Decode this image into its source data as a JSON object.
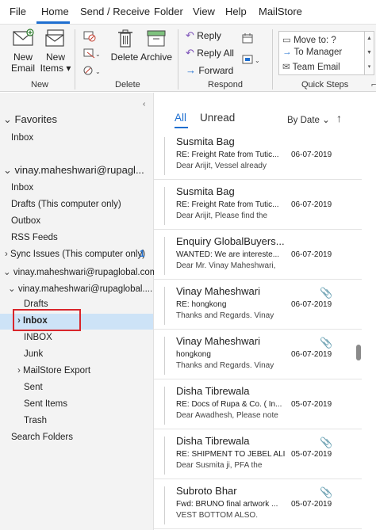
{
  "menu": {
    "items": [
      "File",
      "Home",
      "Send / Receive",
      "Folder",
      "View",
      "Help",
      "MailStore"
    ],
    "active": "Home"
  },
  "ribbon": {
    "new_group": {
      "new_email": [
        "New",
        "Email"
      ],
      "new_items": [
        "New",
        "Items ▾"
      ],
      "label": "New"
    },
    "delete_group": {
      "delete": "Delete",
      "archive": "Archive",
      "label": "Delete"
    },
    "respond_group": {
      "reply": "Reply",
      "reply_all": "Reply All",
      "forward": "Forward",
      "label": "Respond"
    },
    "quick_steps": {
      "items": [
        "Move to: ?",
        "To Manager",
        "Team Email"
      ],
      "label": "Quick Steps"
    }
  },
  "folders": {
    "favorites_header": "Favorites",
    "favorites_inbox": "Inbox",
    "account1": "vinay.maheshwari@rupagl...",
    "inbox": "Inbox",
    "drafts_local": "Drafts (This computer only)",
    "outbox": "Outbox",
    "rss": "RSS Feeds",
    "sync_issues": "Sync Issues (This computer only)",
    "sync_count": "1",
    "account2": "vinay.maheshwari@rupaglobal.com",
    "account2_sub": "vinay.maheshwari@rupaglobal....",
    "drafts": "Drafts",
    "inbox_selected": "Inbox",
    "inbox_caps": "INBOX",
    "junk": "Junk",
    "mailstore_export": "MailStore Export",
    "sent": "Sent",
    "sent_items": "Sent Items",
    "trash": "Trash",
    "search_folders": "Search Folders"
  },
  "list": {
    "tab_all": "All",
    "tab_unread": "Unread",
    "sort_label": "By Date ⌄",
    "sort_direction": "↑"
  },
  "messages": [
    {
      "sender": "Susmita Bag",
      "subject": "RE: Freight Rate from Tutic...",
      "preview": "Dear Arijit,  Vessel already",
      "date": "06-07-2019",
      "attachment": false
    },
    {
      "sender": "Susmita Bag",
      "subject": "RE: Freight Rate from Tutic...",
      "preview": "Dear Arijit,  Please find the",
      "date": "06-07-2019",
      "attachment": false
    },
    {
      "sender": "Enquiry GlobalBuyers...",
      "subject": "WANTED:  We are intereste...",
      "preview": "Dear Mr. Vinay Maheshwari,",
      "date": "06-07-2019",
      "attachment": false
    },
    {
      "sender": "Vinay Maheshwari",
      "subject": "RE: hongkong",
      "preview": "Thanks and Regards.  Vinay",
      "date": "06-07-2019",
      "attachment": true
    },
    {
      "sender": "Vinay Maheshwari",
      "subject": "hongkong",
      "preview": "Thanks and Regards.  Vinay",
      "date": "06-07-2019",
      "attachment": true
    },
    {
      "sender": "Disha Tibrewala",
      "subject": "RE: Docs of Rupa & Co. ( In...",
      "preview": "Dear Awadhesh,  Please note",
      "date": "05-07-2019",
      "attachment": false
    },
    {
      "sender": "Disha Tibrewala",
      "subject": "RE: SHIPMENT TO JEBEL ALI",
      "preview": "Dear Susmita ji,  PFA the",
      "date": "05-07-2019",
      "attachment": true
    },
    {
      "sender": "Subroto Bhar",
      "subject": "Fwd: BRUNO final artwork ...",
      "preview": "VEST BOTTOM ALSO.",
      "date": "05-07-2019",
      "attachment": true
    }
  ]
}
